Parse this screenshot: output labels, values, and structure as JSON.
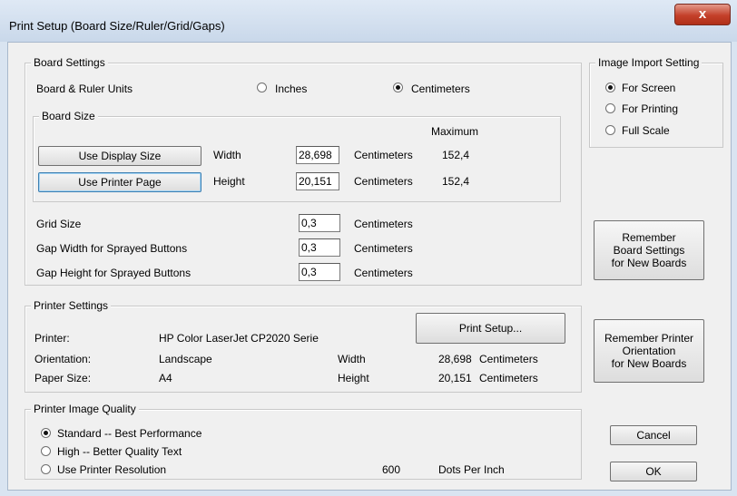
{
  "window": {
    "title": "Print Setup (Board Size/Ruler/Grid/Gaps)",
    "close_glyph": "x"
  },
  "board_settings": {
    "legend": "Board Settings",
    "units_label": "Board & Ruler Units",
    "units_options": [
      {
        "label": "Inches",
        "selected": false
      },
      {
        "label": "Centimeters",
        "selected": true
      }
    ],
    "board_size": {
      "legend": "Board Size",
      "maximum_header": "Maximum",
      "use_display_size_label": "Use Display Size",
      "use_printer_page_label": "Use Printer Page",
      "width_label": "Width",
      "width_value": "28,698",
      "width_unit": "Centimeters",
      "width_max": "152,4",
      "height_label": "Height",
      "height_value": "20,151",
      "height_unit": "Centimeters",
      "height_max": "152,4"
    },
    "grid_size_label": "Grid Size",
    "grid_size_value": "0,3",
    "grid_size_unit": "Centimeters",
    "gap_width_label": "Gap Width for Sprayed Buttons",
    "gap_width_value": "0,3",
    "gap_width_unit": "Centimeters",
    "gap_height_label": "Gap Height for Sprayed Buttons",
    "gap_height_value": "0,3",
    "gap_height_unit": "Centimeters"
  },
  "image_import": {
    "legend": "Image Import Setting",
    "options": [
      {
        "label": "For Screen",
        "selected": true
      },
      {
        "label": "For Printing",
        "selected": false
      },
      {
        "label": "Full Scale",
        "selected": false
      }
    ]
  },
  "remember_board_label": "Remember\nBoard Settings\nfor New Boards",
  "printer_settings": {
    "legend": "Printer Settings",
    "printer_label": "Printer:",
    "printer_value": "HP Color LaserJet CP2020 Serie",
    "print_setup_label": "Print Setup...",
    "orientation_label": "Orientation:",
    "orientation_value": "Landscape",
    "width_label": "Width",
    "width_value": "28,698",
    "width_unit": "Centimeters",
    "paper_size_label": "Paper Size:",
    "paper_size_value": "A4",
    "height_label": "Height",
    "height_value": "20,151",
    "height_unit": "Centimeters"
  },
  "remember_printer_label": "Remember Printer\nOrientation\nfor New Boards",
  "image_quality": {
    "legend": "Printer Image Quality",
    "options": [
      {
        "label": "Standard  --  Best Performance",
        "selected": true
      },
      {
        "label": "High  --  Better Quality Text",
        "selected": false
      },
      {
        "label": "Use Printer Resolution",
        "selected": false
      }
    ],
    "resolution_value": "600",
    "resolution_unit": "Dots Per Inch"
  },
  "cancel_label": "Cancel",
  "ok_label": "OK"
}
